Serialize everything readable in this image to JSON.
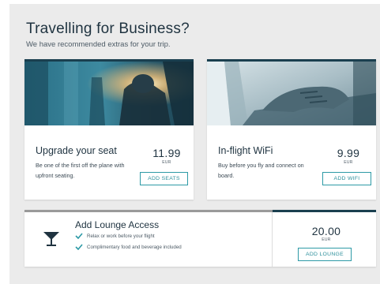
{
  "header": {
    "title": "Travelling for Business?",
    "subtitle": "We have recommended extras for your trip."
  },
  "cards": [
    {
      "title": "Upgrade your seat",
      "description": "Be one of the first off the plane with upfront seating.",
      "price": "11.99",
      "currency": "EUR",
      "button_label": "ADD SEATS",
      "image": "aircraft-cabin-passenger-photo"
    },
    {
      "title": "In-flight WiFi",
      "description": "Buy before you fly and connect on board.",
      "price": "9.99",
      "currency": "EUR",
      "button_label": "ADD WIFI",
      "image": "hands-typing-laptop-photo"
    }
  ],
  "lounge": {
    "title": "Add Lounge Access",
    "icon": "cocktail-glass-icon",
    "benefits": [
      "Relax or work before your flight",
      "Complimentary food and beverage included"
    ],
    "price": "20.00",
    "currency": "EUR",
    "button_label": "ADD LOUNGE"
  },
  "colors": {
    "accent_teal": "#2d9aa6",
    "dark_navy": "#1a3f4f",
    "background_panel": "#ebebeb"
  }
}
